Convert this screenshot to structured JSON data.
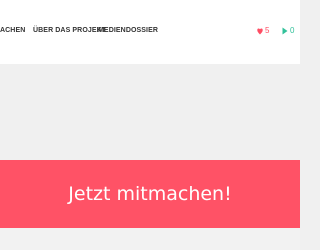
{
  "nav": {
    "items": [
      {
        "label": "ACHEN"
      },
      {
        "label": "ÜBER DAS PROJEKT"
      },
      {
        "label": "MEDIENDOSSIER"
      }
    ]
  },
  "stats": {
    "likes": {
      "icon": "heart-icon",
      "value": "5",
      "color": "#ff4d63"
    },
    "plays": {
      "icon": "play-icon",
      "value": "0",
      "color": "#32c19a"
    }
  },
  "cta": {
    "label": "Jetzt mitmachen!",
    "color": "#ff5266"
  }
}
